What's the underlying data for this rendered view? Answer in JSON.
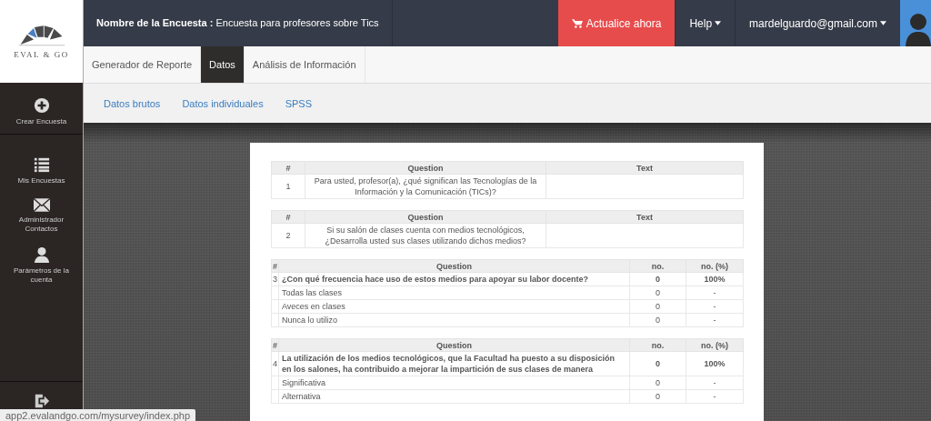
{
  "logo": {
    "text": "EVAL & GO"
  },
  "sidebar": {
    "items": [
      {
        "label": "Crear Encuesta"
      },
      {
        "label": "Mis Encuestas"
      },
      {
        "label": "Administrador Contactos"
      },
      {
        "label": "Parámetros de la cuenta"
      }
    ]
  },
  "topbar": {
    "survey_title": "**Nombre de la Encuesta :** Encuesta para profesores sobre Tics",
    "upgrade_button": "Actualice ahora",
    "help_menu": "Help",
    "account_menu": "mardelguardo@gmail.com"
  },
  "tabs": [
    {
      "label": "Generador de Reporte",
      "selected": false
    },
    {
      "label": "Datos",
      "selected": true
    },
    {
      "label": "Análisis de Información",
      "selected": false
    }
  ],
  "subnav": [
    "Datos brutos",
    "Datos individuales",
    "SPSS"
  ],
  "questions": [
    {
      "kind": "text",
      "columns": [
        "#",
        "Question",
        "Text"
      ],
      "number": "1",
      "question": "Para usted, profesor(a), ¿qué significan las Tecnologías de la Información y la Comunicación (TICs)?"
    },
    {
      "kind": "text",
      "columns": [
        "#",
        "Question",
        "Text"
      ],
      "number": "2",
      "question": "Si su salón de clases cuenta con medios tecnológicos, ¿Desarrolla usted sus clases utilizando dichos medios?"
    },
    {
      "kind": "choice",
      "columns": [
        "#",
        "Question",
        "no.",
        "no. (%)"
      ],
      "number": "3",
      "question": "¿Con qué frecuencia hace uso de estos medios para apoyar su labor docente?",
      "count": "0",
      "percent": "100%",
      "options": [
        {
          "label": "Todas las clases",
          "count": "0",
          "percent": "-"
        },
        {
          "label": "Aveces en clases",
          "count": "0",
          "percent": "-"
        },
        {
          "label": "Nunca lo utilizo",
          "count": "0",
          "percent": "-"
        }
      ]
    },
    {
      "kind": "choice",
      "columns": [
        "#",
        "Question",
        "no.",
        "no. (%)"
      ],
      "number": "4",
      "question": "La utilización de los medios tecnológicos, que la Facultad ha puesto a su disposición en los salones, ha contribuido a mejorar la impartición de sus clases de manera",
      "count": "0",
      "percent": "100%",
      "options": [
        {
          "label": "Significativa",
          "count": "0",
          "percent": "-"
        },
        {
          "label": "Alternativa",
          "count": "0",
          "percent": "-"
        }
      ]
    }
  ],
  "status_bar": "app2.evalandgo.com/mysurvey/index.php"
}
